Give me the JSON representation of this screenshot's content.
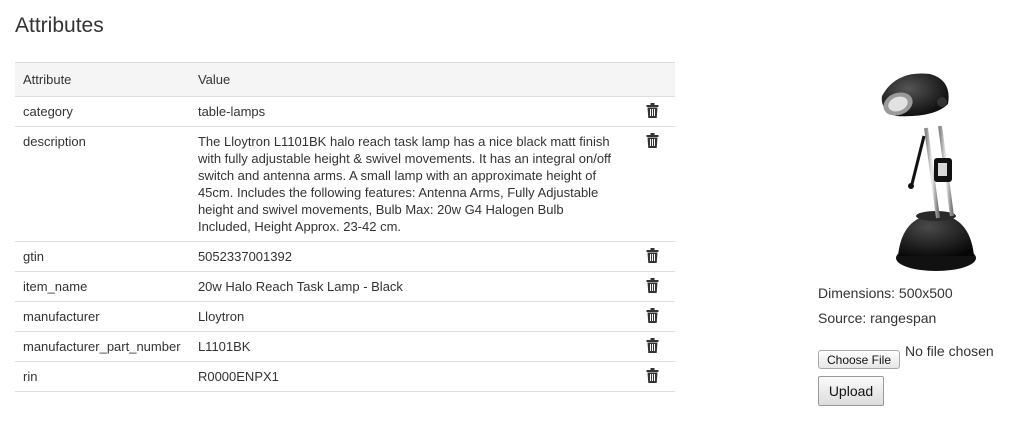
{
  "page": {
    "title": "Attributes"
  },
  "table": {
    "headers": {
      "attribute": "Attribute",
      "value": "Value"
    },
    "rows": [
      {
        "attribute": "category",
        "value": "table-lamps"
      },
      {
        "attribute": "description",
        "value": "The Lloytron L1101BK halo reach task lamp has a nice black matt finish with fully adjustable height & swivel movements. It has an integral on/off switch and antenna arms. A small lamp with an approximate height of 45cm. Includes the following features: Antenna Arms, Fully Adjustable height and swivel movements, Bulb Max: 20w G4 Halogen Bulb Included, Height Approx. 23-42 cm."
      },
      {
        "attribute": "gtin",
        "value": "5052337001392"
      },
      {
        "attribute": "item_name",
        "value": "20w Halo Reach Task Lamp - Black"
      },
      {
        "attribute": "manufacturer",
        "value": "Lloytron"
      },
      {
        "attribute": "manufacturer_part_number",
        "value": "L1101BK"
      },
      {
        "attribute": "rin",
        "value": "R0000ENPX1"
      }
    ],
    "delete_icon": "trash-icon"
  },
  "image_panel": {
    "image_icon": "desk-lamp-product-image",
    "dimensions": "Dimensions: 500x500",
    "source": "Source: rangespan",
    "choose_file_label": "Choose File",
    "no_file_text": "No file chosen",
    "upload_label": "Upload"
  },
  "colors": {
    "border": "#dddddd",
    "header_bg": "#f5f5f5",
    "text": "#333333"
  }
}
